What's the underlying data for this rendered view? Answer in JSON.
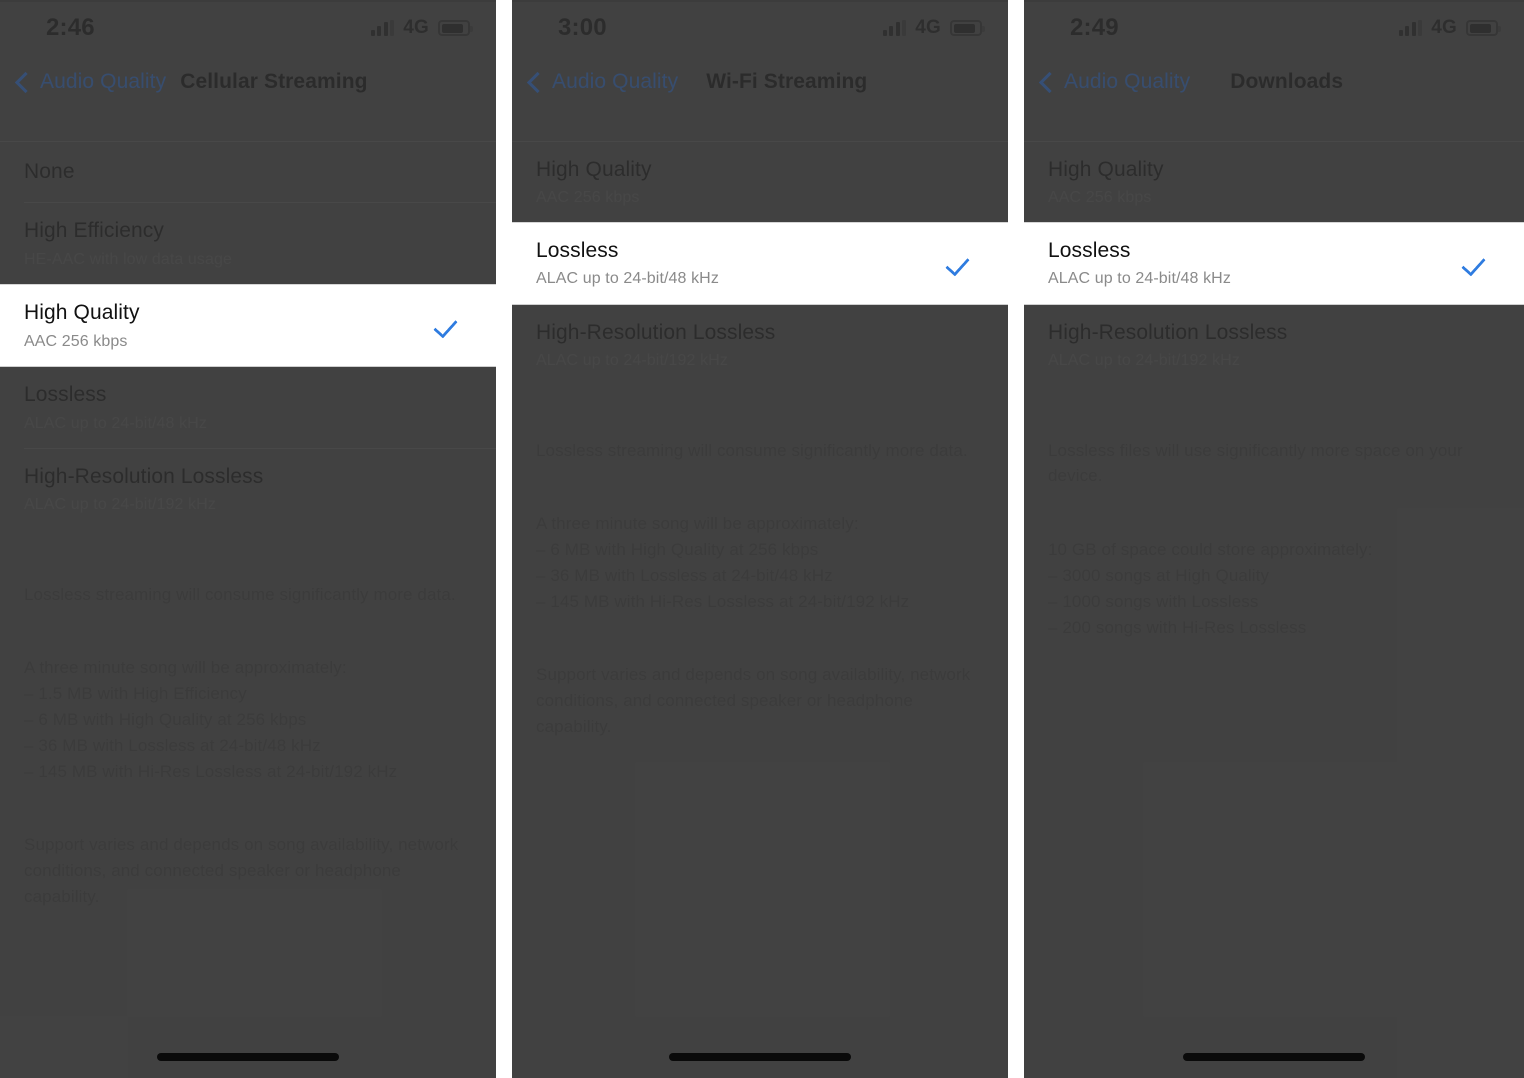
{
  "gap_color": "#ffffff",
  "screens": [
    {
      "id": "cellular-streaming",
      "status": {
        "time": "2:46",
        "network": "4G",
        "battery_level": "78"
      },
      "nav": {
        "back_label": "Audio Quality",
        "title": "Cellular Streaming"
      },
      "rows": [
        {
          "title": "None",
          "sub": "",
          "selected": false,
          "checked": false
        },
        {
          "title": "High Efficiency",
          "sub": "HE-AAC with low data usage",
          "selected": false,
          "checked": false
        },
        {
          "title": "High Quality",
          "sub": "AAC 256 kbps",
          "selected": true,
          "checked": true
        },
        {
          "title": "Lossless",
          "sub": "ALAC up to 24-bit/48 kHz",
          "selected": false,
          "checked": false
        },
        {
          "title": "High-Resolution Lossless",
          "sub": "ALAC up to 24-bit/192 kHz",
          "selected": false,
          "checked": false
        }
      ],
      "note": [
        "Lossless streaming will consume significantly more data.",
        "A three minute song will be approximately:\n– 1.5 MB with High Efficiency\n– 6 MB with High Quality at 256 kbps\n– 36 MB with Lossless at 24-bit/48 kHz\n– 145 MB with Hi-Res Lossless at 24-bit/192 kHz",
        "Support varies and depends on song availability, network conditions, and connected speaker or headphone capability."
      ]
    },
    {
      "id": "wifi-streaming",
      "status": {
        "time": "3:00",
        "network": "4G",
        "battery_level": "78"
      },
      "nav": {
        "back_label": "Audio Quality",
        "title": "Wi-Fi Streaming"
      },
      "rows": [
        {
          "title": "High Quality",
          "sub": "AAC 256 kbps",
          "selected": false,
          "checked": false
        },
        {
          "title": "Lossless",
          "sub": "ALAC up to 24-bit/48 kHz",
          "selected": true,
          "checked": true
        },
        {
          "title": "High-Resolution Lossless",
          "sub": "ALAC up to 24-bit/192 kHz",
          "selected": false,
          "checked": false
        }
      ],
      "note": [
        "Lossless streaming will consume significantly more data.",
        "A three minute song will be approximately:\n– 6 MB with High Quality at 256 kbps\n– 36 MB with Lossless at 24-bit/48 kHz\n– 145 MB with Hi-Res Lossless at 24-bit/192 kHz",
        "Support varies and depends on song availability, network conditions, and connected speaker or headphone capability."
      ]
    },
    {
      "id": "downloads",
      "status": {
        "time": "2:49",
        "network": "4G",
        "battery_level": "78"
      },
      "nav": {
        "back_label": "Audio Quality",
        "title": "Downloads"
      },
      "rows": [
        {
          "title": "High Quality",
          "sub": "AAC 256 kbps",
          "selected": false,
          "checked": false
        },
        {
          "title": "Lossless",
          "sub": "ALAC up to 24-bit/48 kHz",
          "selected": true,
          "checked": true
        },
        {
          "title": "High-Resolution Lossless",
          "sub": "ALAC up to 24-bit/192 kHz",
          "selected": false,
          "checked": false
        }
      ],
      "note": [
        "Lossless files will use significantly more space on your device.",
        "10 GB of space could store approximately:\n– 3000 songs at High Quality\n– 1000 songs with Lossless\n– 200 songs with Hi-Res Lossless"
      ]
    }
  ],
  "colors": {
    "accent_blue": "#2f7ce0",
    "link_blue": "#2d6fd4",
    "dim_background": "#4b4b4b",
    "highlight_row": "#ffffff"
  }
}
